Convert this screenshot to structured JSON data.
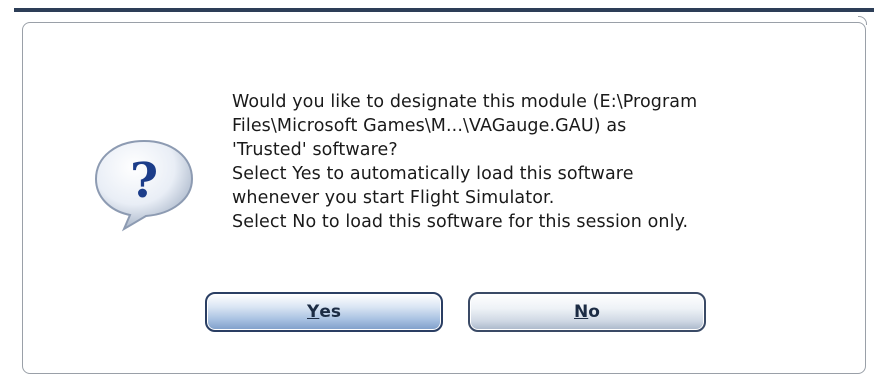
{
  "dialog": {
    "message_lines": [
      "Would you like to designate this module (E:\\Program",
      "Files\\Microsoft Games\\M...\\VAGauge.GAU) as",
      "'Trusted' software?",
      "Select Yes to automatically load this software",
      "whenever you start Flight Simulator.",
      "Select No to load this software for this session only."
    ],
    "icon": "question-icon"
  },
  "buttons": {
    "yes": {
      "accel": "Y",
      "rest": "es"
    },
    "no": {
      "accel": "N",
      "rest": "o"
    }
  },
  "colors": {
    "frame": "#2d3e57",
    "panel_border": "#9aa0a8",
    "button_border": "#2a3e63",
    "icon_fill": "#1c3d8a"
  }
}
